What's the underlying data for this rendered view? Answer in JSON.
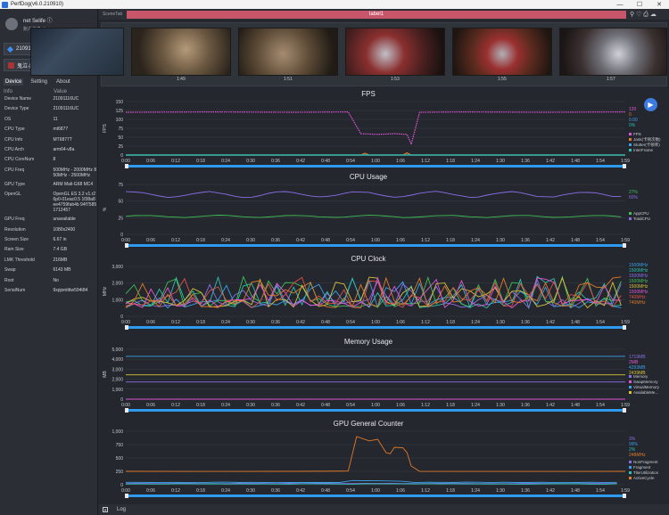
{
  "window": {
    "title": "PerfDog(v6.0.210910)",
    "buttons": [
      "—",
      "☐",
      "✕"
    ]
  },
  "profile": {
    "name": "net Selife ⓘ",
    "sub": "账户信息 ⚙"
  },
  "device_select": {
    "value": "21091116UC",
    "icons": "↺ ✉"
  },
  "app_select": {
    "value": "鬼泣-巅峰之战"
  },
  "sidebar_tabs": [
    "Device",
    "Setting",
    "About"
  ],
  "info_header": {
    "key": "Info",
    "value": "Value"
  },
  "info_rows": [
    {
      "k": "Device Name",
      "v": "21091116UC"
    },
    {
      "k": "Device Type",
      "v": "21091116UC"
    },
    {
      "k": "OS",
      "v": "11"
    },
    {
      "k": "CPU Type",
      "v": "mt6877"
    },
    {
      "k": "CPU Info",
      "v": "MT6877T"
    },
    {
      "k": "CPU Arch",
      "v": "arm64-v8a"
    },
    {
      "k": "CPU CoreNum",
      "v": "8"
    },
    {
      "k": "CPU Freq",
      "v": "500MHz - 2000MHz 850MHz - 2500MHz"
    },
    {
      "k": "GPU Type",
      "v": "ARM Mali-G68 MC4"
    },
    {
      "k": "OpenGL",
      "v": "OpenGL ES 3.2 v1.r26p0-01eac0.5 1f38a8ee4759fab4b 94f75851712457"
    },
    {
      "k": "GPU Freq",
      "v": "unavailable"
    },
    {
      "k": "Resolution",
      "v": "1080x2400"
    },
    {
      "k": "Screen Size",
      "v": "6.67 in"
    },
    {
      "k": "Ram Size",
      "v": "7.4 GB"
    },
    {
      "k": "LMK Threshold",
      "v": "216MB"
    },
    {
      "k": "Swap",
      "v": "6143 MB"
    },
    {
      "k": "Root",
      "v": "No"
    },
    {
      "k": "SerialNum",
      "v": "9xpjonitttw594t84"
    }
  ],
  "scene": {
    "label": "SceneTab",
    "bar_label": "label1",
    "icons": "⚲ ♡ ⎙ ☁"
  },
  "screenshots": {
    "times": [
      "1:49",
      "1:51",
      "1:53",
      "1:55",
      "1:57"
    ]
  },
  "x_ticks": [
    "0:00",
    "0:06",
    "0:12",
    "0:18",
    "0:24",
    "0:30",
    "0:36",
    "0:42",
    "0:48",
    "0:54",
    "1:00",
    "1:06",
    "1:12",
    "1:18",
    "1:24",
    "1:30",
    "1:36",
    "1:42",
    "1:48",
    "1:54",
    "1:59"
  ],
  "bottom": {
    "log_label": "Log"
  },
  "colors": {
    "accent": "#3c7be0",
    "label_bar": "#c7566b",
    "slider": "#2f9bf0"
  },
  "chart_data": [
    {
      "type": "line",
      "title": "FPS",
      "ylabel": "FPS",
      "ylim": [
        0,
        150
      ],
      "yticks": [
        0,
        25,
        50,
        75,
        100,
        125,
        150
      ],
      "x": [
        0,
        10,
        20,
        30,
        40,
        50,
        60,
        70,
        80,
        90,
        100,
        110,
        119
      ],
      "legend_values": [
        "120",
        "0",
        "0.00",
        "0%"
      ],
      "series": [
        {
          "name": "FPS",
          "color": "#e055d8",
          "points": [
            [
              0,
              120
            ],
            [
              20,
              121
            ],
            [
              40,
              120
            ],
            [
              53,
              121
            ],
            [
              56,
              60
            ],
            [
              60,
              58
            ],
            [
              64,
              60
            ],
            [
              67,
              58
            ],
            [
              68,
              30
            ],
            [
              70,
              120
            ],
            [
              80,
              121
            ],
            [
              100,
              120
            ],
            [
              119,
              121
            ]
          ]
        },
        {
          "name": "Jank(卡顿次数)",
          "color": "#e07a2a",
          "points": [
            [
              0,
              0
            ],
            [
              56,
              0
            ],
            [
              57,
              5
            ],
            [
              58,
              0
            ],
            [
              66,
              0
            ],
            [
              67,
              6
            ],
            [
              68,
              0
            ],
            [
              119,
              0
            ]
          ]
        },
        {
          "name": "Stutter(卡顿率)",
          "color": "#3aa0e8",
          "points": [
            [
              0,
              0
            ],
            [
              119,
              0
            ]
          ]
        },
        {
          "name": "InterFrame",
          "color": "#2bc0b0",
          "points": [
            [
              0,
              0
            ],
            [
              119,
              0
            ]
          ]
        }
      ]
    },
    {
      "type": "line",
      "title": "CPU Usage",
      "ylabel": "%",
      "ylim": [
        0,
        75
      ],
      "yticks": [
        0,
        25,
        50,
        75
      ],
      "legend_values": [
        "27%",
        "60%"
      ],
      "series": [
        {
          "name": "AppCPU",
          "color": "#3fbf57",
          "base": 27,
          "amp": 2
        },
        {
          "name": "TotalCPU",
          "color": "#8a6ee8",
          "base": 60,
          "amp": 5
        }
      ]
    },
    {
      "type": "line",
      "title": "CPU Clock",
      "ylabel": "MHz",
      "ylim": [
        0,
        3000
      ],
      "yticks": [
        0,
        1000,
        2000,
        3000
      ],
      "legend_values": [
        "1500MHz",
        "1500MHz",
        "1500MHz",
        "1500MHz",
        "1500MHz",
        "1500MHz",
        "740MHz",
        "740MHz"
      ],
      "series": [
        {
          "name": "CPU0",
          "color": "#3aa0e8"
        },
        {
          "name": "CPU1",
          "color": "#2bc0b0"
        },
        {
          "name": "CPU2",
          "color": "#8a6ee8"
        },
        {
          "name": "CPU3",
          "color": "#3fbf57"
        },
        {
          "name": "CPU4",
          "color": "#d6c33a"
        },
        {
          "name": "CPU5",
          "color": "#e055d8"
        },
        {
          "name": "CPU6",
          "color": "#e0504a"
        },
        {
          "name": "CPU7",
          "color": "#e07a2a"
        }
      ]
    },
    {
      "type": "line",
      "title": "Memory Usage",
      "ylabel": "MB",
      "ylim": [
        0,
        5000
      ],
      "yticks": [
        0,
        1000,
        2000,
        3000,
        4000,
        5000
      ],
      "legend_values": [
        "1719MB",
        "2MB",
        "4293MB",
        "2439MB"
      ],
      "series": [
        {
          "name": "Memory",
          "color": "#8a6ee8",
          "value": 1719
        },
        {
          "name": "SwapMemory",
          "color": "#e055d8",
          "value": 2
        },
        {
          "name": "VirtualMemory",
          "color": "#3aa0e8",
          "value": 4293
        },
        {
          "name": "AvailableMe...",
          "color": "#d6c33a",
          "value": 2439
        }
      ]
    },
    {
      "type": "line",
      "title": "GPU General Counter",
      "ylim": [
        0,
        1000
      ],
      "yticks": [
        0,
        250,
        500,
        750,
        1000
      ],
      "legend_values": [
        "3%",
        "99%",
        "2%",
        "248MHz"
      ],
      "series": [
        {
          "name": "NonFragment",
          "color": "#8a6ee8"
        },
        {
          "name": "Fragment",
          "color": "#3aa0e8"
        },
        {
          "name": "TilerUtilization",
          "color": "#2bc0b0"
        },
        {
          "name": "ActiveCycle",
          "color": "#e07a2a",
          "points": [
            [
              0,
              250
            ],
            [
              20,
              248
            ],
            [
              40,
              250
            ],
            [
              53,
              255
            ],
            [
              55,
              900
            ],
            [
              58,
              820
            ],
            [
              60,
              850
            ],
            [
              62,
              600
            ],
            [
              63,
              580
            ],
            [
              64,
              700
            ],
            [
              66,
              690
            ],
            [
              67,
              600
            ],
            [
              68,
              350
            ],
            [
              70,
              250
            ],
            [
              90,
              248
            ],
            [
              119,
              250
            ]
          ]
        }
      ]
    }
  ]
}
